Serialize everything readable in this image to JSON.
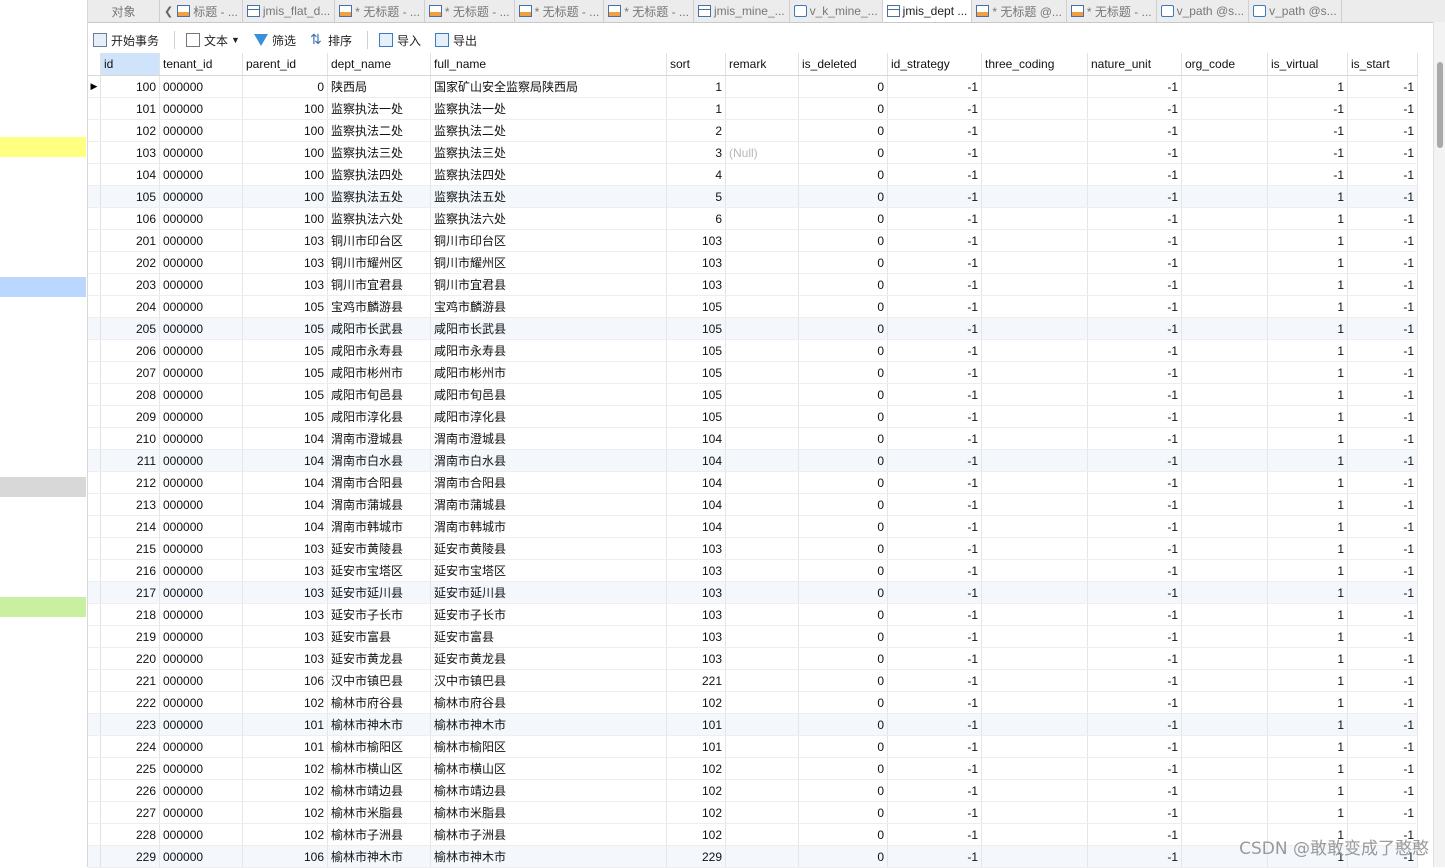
{
  "tabs": [
    {
      "label": "对象",
      "icon": "none",
      "active": false
    },
    {
      "label": "标题 - ...",
      "icon": "query-icon",
      "active": false,
      "chevron": true
    },
    {
      "label": "jmis_flat_d...",
      "icon": "table-icon",
      "active": false
    },
    {
      "label": "* 无标题 - ...",
      "icon": "query-icon",
      "active": false
    },
    {
      "label": "* 无标题 - ...",
      "icon": "query-icon",
      "active": false
    },
    {
      "label": "* 无标题 - ...",
      "icon": "query-icon",
      "active": false
    },
    {
      "label": "* 无标题 - ...",
      "icon": "query-icon",
      "active": false
    },
    {
      "label": "jmis_mine_...",
      "icon": "table-icon",
      "active": false
    },
    {
      "label": "v_k_mine_...",
      "icon": "view-icon",
      "active": false
    },
    {
      "label": "jmis_dept ...",
      "icon": "table-icon",
      "active": true
    },
    {
      "label": "* 无标题 @...",
      "icon": "query-icon",
      "active": false
    },
    {
      "label": "* 无标题 - ...",
      "icon": "query-icon",
      "active": false
    },
    {
      "label": "v_path @s...",
      "icon": "view-icon",
      "active": false
    },
    {
      "label": "v_path @s...",
      "icon": "view-icon",
      "active": false
    }
  ],
  "toolbar": {
    "begin_transaction": "开始事务",
    "text": "文本",
    "filter": "筛选",
    "sort": "排序",
    "import": "导入",
    "export": "导出"
  },
  "columns": [
    "id",
    "tenant_id",
    "parent_id",
    "dept_name",
    "full_name",
    "sort",
    "remark",
    "is_deleted",
    "id_strategy",
    "three_coding",
    "nature_unit",
    "org_code",
    "is_virtual",
    "is_start"
  ],
  "rows": [
    [
      "100",
      "000000",
      "0",
      "陕西局",
      "国家矿山安全监察局陕西局",
      "1",
      "",
      "0",
      "-1",
      "",
      "-1",
      "",
      "1",
      "-1"
    ],
    [
      "101",
      "000000",
      "100",
      "监察执法一处",
      "监察执法一处",
      "1",
      "",
      "0",
      "-1",
      "",
      "-1",
      "",
      "-1",
      "-1"
    ],
    [
      "102",
      "000000",
      "100",
      "监察执法二处",
      "监察执法二处",
      "2",
      "",
      "0",
      "-1",
      "",
      "-1",
      "",
      "-1",
      "-1"
    ],
    [
      "103",
      "000000",
      "100",
      "监察执法三处",
      "监察执法三处",
      "3",
      "(Null)",
      "0",
      "-1",
      "",
      "-1",
      "",
      "-1",
      "-1"
    ],
    [
      "104",
      "000000",
      "100",
      "监察执法四处",
      "监察执法四处",
      "4",
      "",
      "0",
      "-1",
      "",
      "-1",
      "",
      "-1",
      "-1"
    ],
    [
      "105",
      "000000",
      "100",
      "监察执法五处",
      "监察执法五处",
      "5",
      "",
      "0",
      "-1",
      "",
      "-1",
      "",
      "1",
      "-1"
    ],
    [
      "106",
      "000000",
      "100",
      "监察执法六处",
      "监察执法六处",
      "6",
      "",
      "0",
      "-1",
      "",
      "-1",
      "",
      "1",
      "-1"
    ],
    [
      "201",
      "000000",
      "103",
      "铜川市印台区",
      "铜川市印台区",
      "103",
      "",
      "0",
      "-1",
      "",
      "-1",
      "",
      "1",
      "-1"
    ],
    [
      "202",
      "000000",
      "103",
      "铜川市耀州区",
      "铜川市耀州区",
      "103",
      "",
      "0",
      "-1",
      "",
      "-1",
      "",
      "1",
      "-1"
    ],
    [
      "203",
      "000000",
      "103",
      "铜川市宜君县",
      "铜川市宜君县",
      "103",
      "",
      "0",
      "-1",
      "",
      "-1",
      "",
      "1",
      "-1"
    ],
    [
      "204",
      "000000",
      "105",
      "宝鸡市麟游县",
      "宝鸡市麟游县",
      "105",
      "",
      "0",
      "-1",
      "",
      "-1",
      "",
      "1",
      "-1"
    ],
    [
      "205",
      "000000",
      "105",
      "咸阳市长武县",
      "咸阳市长武县",
      "105",
      "",
      "0",
      "-1",
      "",
      "-1",
      "",
      "1",
      "-1"
    ],
    [
      "206",
      "000000",
      "105",
      "咸阳市永寿县",
      "咸阳市永寿县",
      "105",
      "",
      "0",
      "-1",
      "",
      "-1",
      "",
      "1",
      "-1"
    ],
    [
      "207",
      "000000",
      "105",
      "咸阳市彬州市",
      "咸阳市彬州市",
      "105",
      "",
      "0",
      "-1",
      "",
      "-1",
      "",
      "1",
      "-1"
    ],
    [
      "208",
      "000000",
      "105",
      "咸阳市旬邑县",
      "咸阳市旬邑县",
      "105",
      "",
      "0",
      "-1",
      "",
      "-1",
      "",
      "1",
      "-1"
    ],
    [
      "209",
      "000000",
      "105",
      "咸阳市淳化县",
      "咸阳市淳化县",
      "105",
      "",
      "0",
      "-1",
      "",
      "-1",
      "",
      "1",
      "-1"
    ],
    [
      "210",
      "000000",
      "104",
      "渭南市澄城县",
      "渭南市澄城县",
      "104",
      "",
      "0",
      "-1",
      "",
      "-1",
      "",
      "1",
      "-1"
    ],
    [
      "211",
      "000000",
      "104",
      "渭南市白水县",
      "渭南市白水县",
      "104",
      "",
      "0",
      "-1",
      "",
      "-1",
      "",
      "1",
      "-1"
    ],
    [
      "212",
      "000000",
      "104",
      "渭南市合阳县",
      "渭南市合阳县",
      "104",
      "",
      "0",
      "-1",
      "",
      "-1",
      "",
      "1",
      "-1"
    ],
    [
      "213",
      "000000",
      "104",
      "渭南市蒲城县",
      "渭南市蒲城县",
      "104",
      "",
      "0",
      "-1",
      "",
      "-1",
      "",
      "1",
      "-1"
    ],
    [
      "214",
      "000000",
      "104",
      "渭南市韩城市",
      "渭南市韩城市",
      "104",
      "",
      "0",
      "-1",
      "",
      "-1",
      "",
      "1",
      "-1"
    ],
    [
      "215",
      "000000",
      "103",
      "延安市黄陵县",
      "延安市黄陵县",
      "103",
      "",
      "0",
      "-1",
      "",
      "-1",
      "",
      "1",
      "-1"
    ],
    [
      "216",
      "000000",
      "103",
      "延安市宝塔区",
      "延安市宝塔区",
      "103",
      "",
      "0",
      "-1",
      "",
      "-1",
      "",
      "1",
      "-1"
    ],
    [
      "217",
      "000000",
      "103",
      "延安市延川县",
      "延安市延川县",
      "103",
      "",
      "0",
      "-1",
      "",
      "-1",
      "",
      "1",
      "-1"
    ],
    [
      "218",
      "000000",
      "103",
      "延安市子长市",
      "延安市子长市",
      "103",
      "",
      "0",
      "-1",
      "",
      "-1",
      "",
      "1",
      "-1"
    ],
    [
      "219",
      "000000",
      "103",
      "延安市富县",
      "延安市富县",
      "103",
      "",
      "0",
      "-1",
      "",
      "-1",
      "",
      "1",
      "-1"
    ],
    [
      "220",
      "000000",
      "103",
      "延安市黄龙县",
      "延安市黄龙县",
      "103",
      "",
      "0",
      "-1",
      "",
      "-1",
      "",
      "1",
      "-1"
    ],
    [
      "221",
      "000000",
      "106",
      "汉中市镇巴县",
      "汉中市镇巴县",
      "221",
      "",
      "0",
      "-1",
      "",
      "-1",
      "",
      "1",
      "-1"
    ],
    [
      "222",
      "000000",
      "102",
      "榆林市府谷县",
      "榆林市府谷县",
      "102",
      "",
      "0",
      "-1",
      "",
      "-1",
      "",
      "1",
      "-1"
    ],
    [
      "223",
      "000000",
      "101",
      "榆林市神木市",
      "榆林市神木市",
      "101",
      "",
      "0",
      "-1",
      "",
      "-1",
      "",
      "1",
      "-1"
    ],
    [
      "224",
      "000000",
      "101",
      "榆林市榆阳区",
      "榆林市榆阳区",
      "101",
      "",
      "0",
      "-1",
      "",
      "-1",
      "",
      "1",
      "-1"
    ],
    [
      "225",
      "000000",
      "102",
      "榆林市横山区",
      "榆林市横山区",
      "102",
      "",
      "0",
      "-1",
      "",
      "-1",
      "",
      "1",
      "-1"
    ],
    [
      "226",
      "000000",
      "102",
      "榆林市靖边县",
      "榆林市靖边县",
      "102",
      "",
      "0",
      "-1",
      "",
      "-1",
      "",
      "1",
      "-1"
    ],
    [
      "227",
      "000000",
      "102",
      "榆林市米脂县",
      "榆林市米脂县",
      "102",
      "",
      "0",
      "-1",
      "",
      "-1",
      "",
      "1",
      "-1"
    ],
    [
      "228",
      "000000",
      "102",
      "榆林市子洲县",
      "榆林市子洲县",
      "102",
      "",
      "0",
      "-1",
      "",
      "-1",
      "",
      "1",
      "-1"
    ],
    [
      "229",
      "000000",
      "106",
      "榆林市神木市",
      "榆林市神木市",
      "229",
      "",
      "0",
      "-1",
      "",
      "-1",
      "",
      "1",
      "-1"
    ]
  ],
  "left_markers": [
    {
      "color": "#ffff80"
    },
    {
      "color": "#bcd7ff"
    },
    {
      "color": "#d8d8d8"
    },
    {
      "color": "#c8f0a0"
    }
  ],
  "watermark": "CSDN @敢敢变成了憨憨"
}
